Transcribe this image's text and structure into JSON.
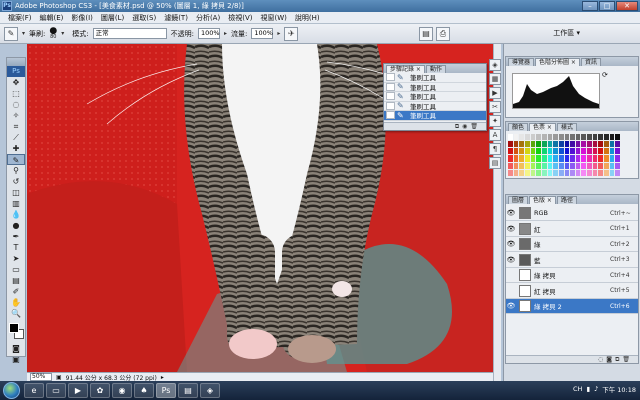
{
  "window": {
    "title": "Adobe Photoshop CS3 - [美食素材.psd @ 50% (圖層 1, 綠 拷貝 2/8)]",
    "app_icon": "Ps"
  },
  "menu": [
    "檔案(F)",
    "編輯(E)",
    "影像(I)",
    "圖層(L)",
    "選取(S)",
    "濾鏡(T)",
    "分析(A)",
    "檢視(V)",
    "視窗(W)",
    "說明(H)"
  ],
  "options": {
    "brush_label": "筆刷:",
    "brush_size": "80",
    "mode_label": "模式:",
    "mode_value": "正常",
    "opacity_label": "不透明:",
    "opacity_value": "100%",
    "flow_label": "流量:",
    "flow_value": "100%",
    "workspace_label": "工作區 ▾"
  },
  "history_panel": {
    "tabs": [
      "步驟記錄 ×",
      "動作"
    ],
    "items": [
      {
        "label": "筆刷工具",
        "selected": false
      },
      {
        "label": "筆刷工具",
        "selected": false
      },
      {
        "label": "筆刷工具",
        "selected": false
      },
      {
        "label": "筆刷工具",
        "selected": false
      },
      {
        "label": "筆刷工具",
        "selected": true
      }
    ]
  },
  "nav_panel": {
    "tabs": [
      "導覽器",
      "色階分佈圖 ×",
      "資訊"
    ]
  },
  "swatch_panel": {
    "tabs": [
      "顏色",
      "色票 ×",
      "樣式"
    ]
  },
  "channel_panel": {
    "tabs": [
      "圖層",
      "色版 ×",
      "路徑"
    ],
    "channels": [
      {
        "name": "RGB",
        "key": "Ctrl+~",
        "visible": true,
        "selected": false,
        "thumb": "#777"
      },
      {
        "name": "紅",
        "key": "Ctrl+1",
        "visible": true,
        "selected": false,
        "thumb": "#888"
      },
      {
        "name": "綠",
        "key": "Ctrl+2",
        "visible": true,
        "selected": false,
        "thumb": "#6a6a6a"
      },
      {
        "name": "藍",
        "key": "Ctrl+3",
        "visible": true,
        "selected": false,
        "thumb": "#5a5a5a"
      },
      {
        "name": "綠 拷貝",
        "key": "Ctrl+4",
        "visible": false,
        "selected": false,
        "thumb": "#fff"
      },
      {
        "name": "紅 拷貝",
        "key": "Ctrl+5",
        "visible": false,
        "selected": false,
        "thumb": "#fff"
      },
      {
        "name": "綠 拷貝 2",
        "key": "Ctrl+6",
        "visible": true,
        "selected": true,
        "thumb": "#fff"
      }
    ]
  },
  "status": {
    "zoom": "50%",
    "doc_info": "91.44 公分 x 68.3 公分 (72 ppi)"
  },
  "taskbar": {
    "clock": "下午 10:18",
    "lang": "CH"
  },
  "colors": {
    "accent": "#3b78c6",
    "canvas_red": "#d6231f"
  }
}
